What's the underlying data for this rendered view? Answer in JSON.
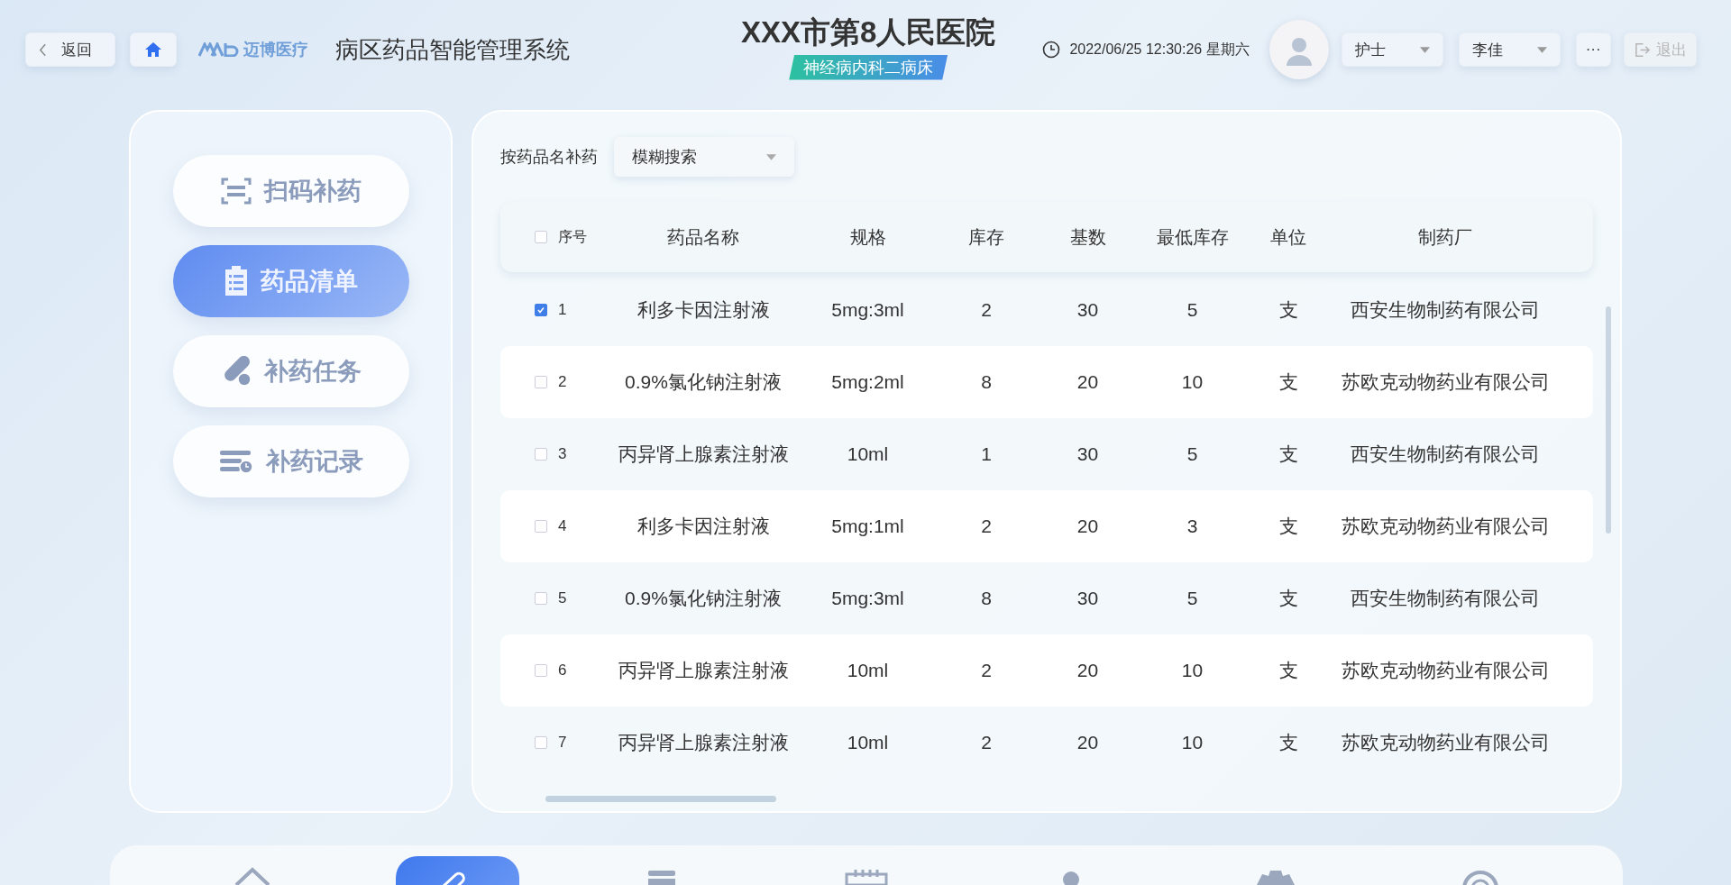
{
  "header": {
    "back_button": "返回",
    "logo_text": "迈博医疗",
    "system_title": "病区药品智能管理系统",
    "hospital_name": "XXX市第8人民医院",
    "department": "神经病内科二病床",
    "datetime": "2022/06/25 12:30:26 星期六",
    "role_select": "护士",
    "user_select": "李佳",
    "more_button": "···",
    "logout": {
      "label": "退出",
      "disabled": true
    }
  },
  "sidebar": {
    "items": [
      {
        "label": "扫码补药",
        "kind": "scan",
        "selected": false
      },
      {
        "label": "药品清单",
        "kind": "list",
        "selected": true
      },
      {
        "label": "补药任务",
        "kind": "pill",
        "selected": false
      },
      {
        "label": "补药记录",
        "kind": "record",
        "selected": false
      }
    ]
  },
  "search": {
    "label": "按药品名补药",
    "select_value": "模糊搜索"
  },
  "table": {
    "header_checked": false,
    "columns": [
      "序号",
      "药品名称",
      "规格",
      "库存",
      "基数",
      "最低库存",
      "单位",
      "制药厂"
    ],
    "rows": [
      {
        "checked": true,
        "cells": [
          "1",
          "利多卡因注射液",
          "5mg:3ml",
          "2",
          "30",
          "5",
          "支",
          "西安生物制药有限公司"
        ]
      },
      {
        "checked": false,
        "cells": [
          "2",
          "0.9%氯化钠注射液",
          "5mg:2ml",
          "8",
          "20",
          "10",
          "支",
          "苏欧克动物药业有限公司"
        ]
      },
      {
        "checked": false,
        "cells": [
          "3",
          "丙异肾上腺素注射液",
          "10ml",
          "1",
          "30",
          "5",
          "支",
          "西安生物制药有限公司"
        ]
      },
      {
        "checked": false,
        "cells": [
          "4",
          "利多卡因注射液",
          "5mg:1ml",
          "2",
          "20",
          "3",
          "支",
          "苏欧克动物药业有限公司"
        ]
      },
      {
        "checked": false,
        "cells": [
          "5",
          "0.9%氯化钠注射液",
          "5mg:3ml",
          "8",
          "30",
          "5",
          "支",
          "西安生物制药有限公司"
        ]
      },
      {
        "checked": false,
        "cells": [
          "6",
          "丙异肾上腺素注射液",
          "10ml",
          "2",
          "20",
          "10",
          "支",
          "苏欧克动物药业有限公司"
        ]
      },
      {
        "checked": false,
        "cells": [
          "7",
          "丙异肾上腺素注射液",
          "10ml",
          "2",
          "20",
          "10",
          "支",
          "苏欧克动物药业有限公司"
        ]
      }
    ]
  },
  "bottom_nav": {
    "items": [
      {
        "kind": "home",
        "selected": false
      },
      {
        "kind": "pill",
        "selected": true
      },
      {
        "kind": "list",
        "selected": false
      },
      {
        "kind": "calendar",
        "selected": false
      },
      {
        "kind": "person",
        "selected": false
      },
      {
        "kind": "gear",
        "selected": false
      },
      {
        "kind": "gauge",
        "selected": false
      }
    ]
  }
}
